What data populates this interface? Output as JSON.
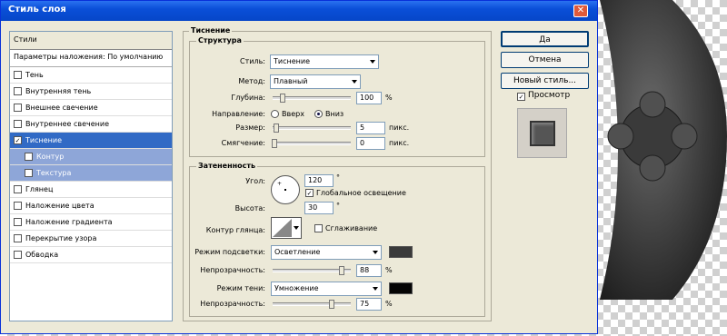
{
  "window": {
    "title": "Стиль слоя"
  },
  "sidebar": {
    "header": "Стили",
    "blend_options": "Параметры наложения: По умолчанию",
    "items": [
      {
        "label": "Тень",
        "checked": false,
        "kind": "normal"
      },
      {
        "label": "Внутренняя тень",
        "checked": false,
        "kind": "normal"
      },
      {
        "label": "Внешнее свечение",
        "checked": false,
        "kind": "normal"
      },
      {
        "label": "Внутреннее свечение",
        "checked": false,
        "kind": "normal"
      },
      {
        "label": "Тиснение",
        "checked": true,
        "kind": "selected"
      },
      {
        "label": "Контур",
        "checked": false,
        "kind": "sub"
      },
      {
        "label": "Текстура",
        "checked": false,
        "kind": "sub"
      },
      {
        "label": "Глянец",
        "checked": false,
        "kind": "normal"
      },
      {
        "label": "Наложение цвета",
        "checked": false,
        "kind": "normal"
      },
      {
        "label": "Наложение градиента",
        "checked": false,
        "kind": "normal"
      },
      {
        "label": "Перекрытие узора",
        "checked": false,
        "kind": "normal"
      },
      {
        "label": "Обводка",
        "checked": false,
        "kind": "normal"
      }
    ]
  },
  "bevel": {
    "section_title": "Тиснение",
    "structure": {
      "title": "Структура",
      "style_label": "Стиль:",
      "style_value": "Тиснение",
      "method_label": "Метод:",
      "method_value": "Плавный",
      "depth_label": "Глубина:",
      "depth_value": "100",
      "depth_unit": "%",
      "direction_label": "Направление:",
      "dir_up": "Вверх",
      "dir_down": "Вниз",
      "size_label": "Размер:",
      "size_value": "5",
      "size_unit": "пикс.",
      "soften_label": "Смягчение:",
      "soften_value": "0",
      "soften_unit": "пикс."
    },
    "shading": {
      "title": "Затененность",
      "angle_label": "Угол:",
      "angle_value": "120",
      "angle_unit": "°",
      "global_light": "Глобальное освещение",
      "altitude_label": "Высота:",
      "altitude_value": "30",
      "altitude_unit": "°",
      "gloss_label": "Контур глянца:",
      "antialias": "Сглаживание",
      "highlight_mode_label": "Режим подсветки:",
      "highlight_mode": "Осветление",
      "highlight_color": "#3a3a3a",
      "highlight_opacity_label": "Непрозрачность:",
      "highlight_opacity": "88",
      "highlight_opacity_unit": "%",
      "shadow_mode_label": "Режим тени:",
      "shadow_mode": "Умножение",
      "shadow_color": "#050505",
      "shadow_opacity_label": "Непрозрачность:",
      "shadow_opacity": "75",
      "shadow_opacity_unit": "%"
    }
  },
  "buttons": {
    "ok": "Да",
    "cancel": "Отмена",
    "new_style": "Новый стиль...",
    "preview_label": "Просмотр",
    "preview_checked": true
  }
}
